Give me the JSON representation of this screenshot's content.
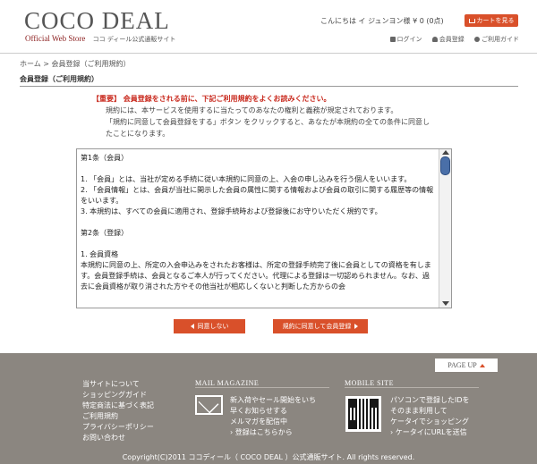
{
  "header": {
    "logo_main": "COCO DEAL",
    "logo_serif": "Official Web Store",
    "logo_jp": "ココ ディール公式通販サイト",
    "greeting": "こんにちは イ ジュンヨン様 ¥ 0 (0点)",
    "cart_label": "カートを見る",
    "links": [
      "ログイン",
      "会員登録",
      "ご利用ガイド"
    ]
  },
  "breadcrumb": "ホーム > 会員登録（ご利用規約）",
  "page_title": "会員登録（ご利用規約）",
  "notice": {
    "important": "【重要】 会員登録をされる前に、下記ご利用規約をよくお読みください。",
    "line1": "規約には、本サービスを使用するに当たってのあなたの権利と義務が規定されております。",
    "line2": "「規約に同意して会員登録をする」ボタン をクリックすると、あなたが本規約の全ての条件に同意し",
    "line3": "たことになります。"
  },
  "terms": {
    "lines": [
      "第1条（会員）",
      "",
      "1. 「会員」とは、当社が定める手続に従い本規約に同意の上、入会の申し込みを行う個人をいいます。",
      "2. 「会員情報」とは、会員が当社に開示した会員の属性に関する情報および会員の取引に関する履歴等の情報をいいます。",
      "3. 本規約は、すべての会員に適用され、登録手続時および登録後にお守りいただく規約です。",
      "",
      "第2条（登録）",
      "",
      "1. 会員資格",
      "本規約に同意の上、所定の入会申込みをされたお客様は、所定の登録手続完了後に会員としての資格を有します。会員登録手続は、会員となるご本人が行ってください。代理による登録は一切認められません。なお、過去に会員資格が取り消された方やその他当社が相応しくないと判断した方からの会"
    ]
  },
  "buttons": {
    "disagree": "同意しない",
    "agree": "規約に同意して会員登録"
  },
  "footer": {
    "page_up": "PAGE UP",
    "links": [
      "当サイトについて",
      "ショッピングガイド",
      "特定商法に基づく表記",
      "ご利用規約",
      "プライバシーポリシー",
      "お問い合わせ"
    ],
    "mail_title": "MAIL MAGAZINE",
    "mail_lines": [
      "新入荷やセール開始をいち",
      "早くお知らせする",
      "メルマガを配信中"
    ],
    "mail_link": "› 登録はこちらから",
    "mobile_title": "MOBILE SITE",
    "mobile_lines": [
      "パソコンで登録したIDを",
      "そのまま利用して",
      "ケータイでショッピング"
    ],
    "mobile_link": "› ケータイにURLを送信",
    "copyright": "Copyright(C)2011 ココディール（ COCO DEAL ）公式通販サイト. All rights reserved."
  },
  "colors": {
    "accent": "#d9502a",
    "important": "#c8281c",
    "footer_bg": "#8b8680"
  }
}
